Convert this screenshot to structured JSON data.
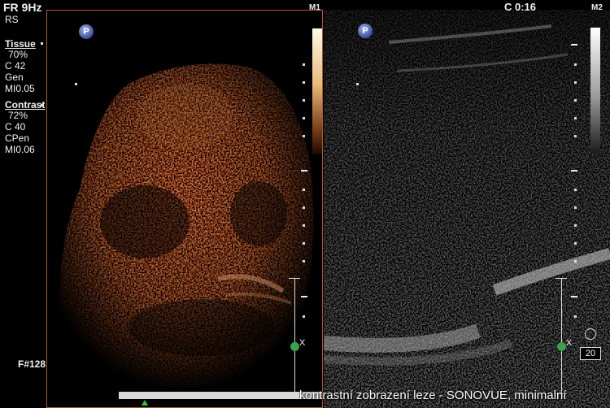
{
  "header": {
    "fr": "FR 9Hz",
    "rs": "RS",
    "clock": "C 0:16",
    "m1": "M1",
    "m2": "M2"
  },
  "tissue": {
    "heading": "Tissue",
    "pct": "70%",
    "c": "C 42",
    "mode": "Gen",
    "mi": "MI0.05"
  },
  "contrast": {
    "heading": "Contrast",
    "pct": "72%",
    "c": "C 40",
    "mode": "CPen",
    "mi": "MI0.06"
  },
  "frame": "F#128",
  "badge": "P",
  "x_marker": "X",
  "depth_value": "20",
  "caption": "kontrastní zobrazení leze - SONOVUE, minimalní"
}
